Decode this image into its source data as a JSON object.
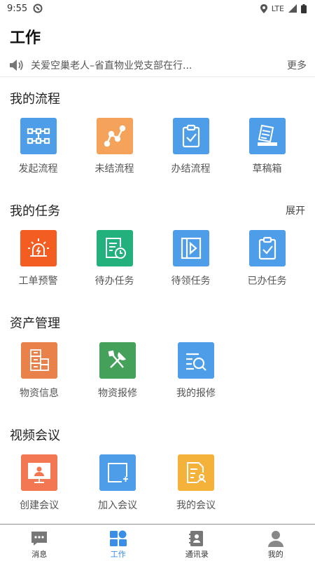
{
  "status_bar": {
    "time": "9:55",
    "network": "LTE"
  },
  "header": {
    "title": "工作"
  },
  "notice": {
    "text": "关爱空巢老人–省直物业党支部在行...",
    "more_label": "更多",
    "icon": "speaker-icon"
  },
  "sections": [
    {
      "title": "我的流程",
      "action": "",
      "items": [
        {
          "label": "发起流程",
          "icon": "workflow-nodes-icon",
          "color": "#4d9de8"
        },
        {
          "label": "未结流程",
          "icon": "path-curve-icon",
          "color": "#f5a25a"
        },
        {
          "label": "办结流程",
          "icon": "clipboard-check-icon",
          "color": "#4d9de8"
        },
        {
          "label": "草稿箱",
          "icon": "draft-box-icon",
          "color": "#4d9de8"
        }
      ]
    },
    {
      "title": "我的任务",
      "action": "展开",
      "items": [
        {
          "label": "工单预警",
          "icon": "alarm-light-icon",
          "color": "#f45d22"
        },
        {
          "label": "待办任务",
          "icon": "document-clock-icon",
          "color": "#22b07d"
        },
        {
          "label": "待领任务",
          "icon": "claim-arrow-icon",
          "color": "#4d9de8"
        },
        {
          "label": "已办任务",
          "icon": "clipboard-check-icon",
          "color": "#4d9de8"
        }
      ]
    },
    {
      "title": "资产管理",
      "action": "",
      "items": [
        {
          "label": "物资信息",
          "icon": "stacked-boxes-icon",
          "color": "#e8814a"
        },
        {
          "label": "物资报修",
          "icon": "tools-icon",
          "color": "#43a15a"
        },
        {
          "label": "我的报修",
          "icon": "list-search-icon",
          "color": "#4d9de8"
        }
      ]
    },
    {
      "title": "视频会议",
      "action": "",
      "items": [
        {
          "label": "创建会议",
          "icon": "monitor-user-icon",
          "color": "#f37752"
        },
        {
          "label": "加入会议",
          "icon": "add-window-icon",
          "color": "#4d9de8"
        },
        {
          "label": "我的会议",
          "icon": "document-user-icon",
          "color": "#f5b23a"
        }
      ]
    }
  ],
  "tabbar": {
    "items": [
      {
        "label": "消息",
        "icon": "message-icon",
        "active": false
      },
      {
        "label": "工作",
        "icon": "grid-apps-icon",
        "active": true
      },
      {
        "label": "通讯录",
        "icon": "contacts-icon",
        "active": false
      },
      {
        "label": "我的",
        "icon": "profile-icon",
        "active": false
      }
    ],
    "active_color": "#3a8ee6"
  }
}
